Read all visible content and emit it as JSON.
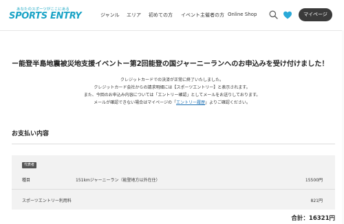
{
  "header": {
    "logo_tag": "あなたのスポーツがここにある",
    "logo_text": "SPORTS ENTRY",
    "nav": [
      "ジャンル",
      "エリア",
      "初めての方",
      "イベント主催者の方",
      "Online Shop"
    ],
    "mypage_label": "マイページ",
    "icons": {
      "search": "search-icon",
      "favorite": "heart-icon"
    },
    "colors": {
      "brand": "#1aa3c6",
      "favorite": "#29a9d8",
      "button": "#3a3a3a"
    }
  },
  "main": {
    "title": "ー能登半島地震被災地支援イベントー第2回能登の国ジャーニーランへのお申込みを受け付けました！",
    "messages": {
      "line1": "クレジットカードでの決済が正常に終了いたしました。",
      "line2": "クレジットカード会社からの請求明細には【スポーツエントリー】と表示されます。",
      "line3": "また、今回のお申込み内容については「エントリー確認」としてメールをお送りしております。",
      "line4_pre": "メールが確認できない場合はマイページの「",
      "line4_link": "エントリー履歴",
      "line4_post": "」よりご確認ください。"
    }
  },
  "payment": {
    "section_title": "お支払い内容",
    "badge": "代表者",
    "item_label": "種目",
    "item_name": "151kmジャーニーラン（能登地方以外在住）",
    "item_amount": "15500円",
    "fee_label": "スポーツエントリー利用料",
    "fee_amount": "821円",
    "total": "合計：16321円"
  }
}
